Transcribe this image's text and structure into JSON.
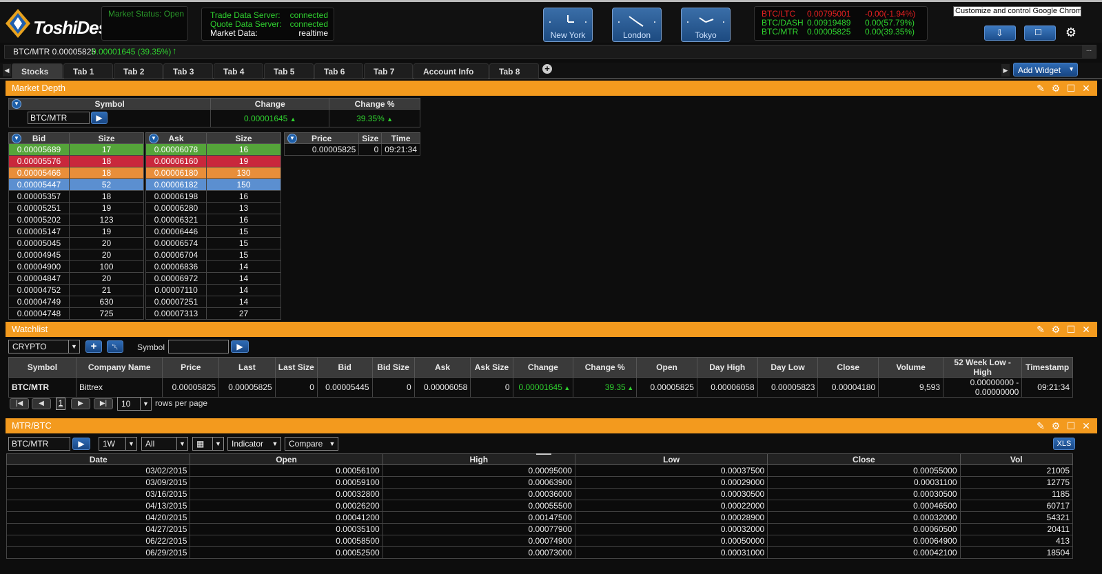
{
  "app": {
    "name": "ToshiDesk"
  },
  "market_status": "Market Status: Open",
  "servers": {
    "trade_label": "Trade Data Server:",
    "trade_value": "connected",
    "quote_label": "Quote Data Server:",
    "quote_value": "connected",
    "market_label": "Market Data:",
    "market_value": "realtime"
  },
  "clocks": [
    {
      "label": "New York"
    },
    {
      "label": "London"
    },
    {
      "label": "Tokyo"
    }
  ],
  "quotes": [
    {
      "symbol": "BTC/LTC",
      "price": "0.00795001",
      "change": "-0.00(-1.94%)",
      "color": "#e02020"
    },
    {
      "symbol": "BTC/DASH",
      "price": "0.00919489",
      "change": "0.00(57.79%)",
      "color": "#2fd12f"
    },
    {
      "symbol": "BTC/MTR",
      "price": "0.00005825",
      "change": "0.00(39.35%)",
      "color": "#2fd12f"
    }
  ],
  "tooltip": "Customize and control Google Chrome",
  "ticker": {
    "symbol_price": "BTC/MTR 0.00005825",
    "change": "0.00001645 (39.35%)"
  },
  "tabs": [
    "Stocks",
    "Tab 1",
    "Tab 2",
    "Tab 3",
    "Tab 4",
    "Tab 5",
    "Tab 6",
    "Tab 7",
    "Account Info",
    "Tab 8"
  ],
  "add_widget": "Add Widget",
  "market_depth": {
    "title": "Market Depth",
    "symbol_header": "Symbol",
    "change_header": "Change",
    "change_pct_header": "Change %",
    "symbol_value": "BTC/MTR",
    "change_value": "0.00001645",
    "change_pct_value": "39.35%",
    "bid_header": "Bid",
    "size_header": "Size",
    "ask_header": "Ask",
    "price_header": "Price",
    "time_header": "Time",
    "trade": {
      "price": "0.00005825",
      "size": "0",
      "time": "09:21:34"
    },
    "bids": [
      [
        "0.00005689",
        "17"
      ],
      [
        "0.00005576",
        "18"
      ],
      [
        "0.00005466",
        "18"
      ],
      [
        "0.00005447",
        "52"
      ],
      [
        "0.00005357",
        "18"
      ],
      [
        "0.00005251",
        "19"
      ],
      [
        "0.00005202",
        "123"
      ],
      [
        "0.00005147",
        "19"
      ],
      [
        "0.00005045",
        "20"
      ],
      [
        "0.00004945",
        "20"
      ],
      [
        "0.00004900",
        "100"
      ],
      [
        "0.00004847",
        "20"
      ],
      [
        "0.00004752",
        "21"
      ],
      [
        "0.00004749",
        "630"
      ],
      [
        "0.00004748",
        "725"
      ]
    ],
    "asks": [
      [
        "0.00006078",
        "16"
      ],
      [
        "0.00006160",
        "19"
      ],
      [
        "0.00006180",
        "130"
      ],
      [
        "0.00006182",
        "150"
      ],
      [
        "0.00006198",
        "16"
      ],
      [
        "0.00006280",
        "13"
      ],
      [
        "0.00006321",
        "16"
      ],
      [
        "0.00006446",
        "15"
      ],
      [
        "0.00006574",
        "15"
      ],
      [
        "0.00006704",
        "15"
      ],
      [
        "0.00006836",
        "14"
      ],
      [
        "0.00006972",
        "14"
      ],
      [
        "0.00007110",
        "14"
      ],
      [
        "0.00007251",
        "14"
      ],
      [
        "0.00007313",
        "27"
      ]
    ],
    "level_colors": [
      "#55a43a",
      "#c9283c",
      "#e88e3a",
      "#5b8fd0"
    ]
  },
  "watchlist": {
    "title": "Watchlist",
    "list_value": "CRYPTO",
    "symbol_label": "Symbol",
    "columns": [
      "Symbol",
      "Company Name",
      "Price",
      "Last",
      "Last Size",
      "Bid",
      "Bid Size",
      "Ask",
      "Ask Size",
      "Change",
      "Change %",
      "Open",
      "Day High",
      "Day Low",
      "Close",
      "Volume",
      "52 Week Low - High",
      "Timestamp"
    ],
    "row": [
      "BTC/MTR",
      "Bittrex",
      "0.00005825",
      "0.00005825",
      "0",
      "0.00005445",
      "0",
      "0.00006058",
      "0",
      "0.00001645",
      "39.35",
      "0.00005825",
      "0.00006058",
      "0.00005823",
      "0.00004180",
      "9,593",
      "0.00000000 - 0.00000000",
      "09:21:34"
    ],
    "page": "1",
    "rows_per_page": "10",
    "rows_per_page_label": "rows per page"
  },
  "history": {
    "title": "MTR/BTC",
    "symbol_value": "BTC/MTR",
    "period": "1W",
    "range": "All",
    "indicator": "Indicator",
    "compare": "Compare",
    "xls": "XLS",
    "columns": [
      "Date",
      "Open",
      "High",
      "Low",
      "Close",
      "Vol"
    ],
    "rows": [
      [
        "03/02/2015",
        "0.00056100",
        "0.00095000",
        "0.00037500",
        "0.00055000",
        "21005"
      ],
      [
        "03/09/2015",
        "0.00059100",
        "0.00063900",
        "0.00029000",
        "0.00031100",
        "12775"
      ],
      [
        "03/16/2015",
        "0.00032800",
        "0.00036000",
        "0.00030500",
        "0.00030500",
        "1185"
      ],
      [
        "04/13/2015",
        "0.00026200",
        "0.00055500",
        "0.00022000",
        "0.00046500",
        "60717"
      ],
      [
        "04/20/2015",
        "0.00041200",
        "0.00147500",
        "0.00028900",
        "0.00032000",
        "54321"
      ],
      [
        "04/27/2015",
        "0.00035100",
        "0.00077900",
        "0.00032000",
        "0.00060500",
        "20411"
      ],
      [
        "06/22/2015",
        "0.00058500",
        "0.00074900",
        "0.00050000",
        "0.00064900",
        "413"
      ],
      [
        "06/29/2015",
        "0.00052500",
        "0.00073000",
        "0.00031000",
        "0.00042100",
        "18504"
      ]
    ]
  }
}
